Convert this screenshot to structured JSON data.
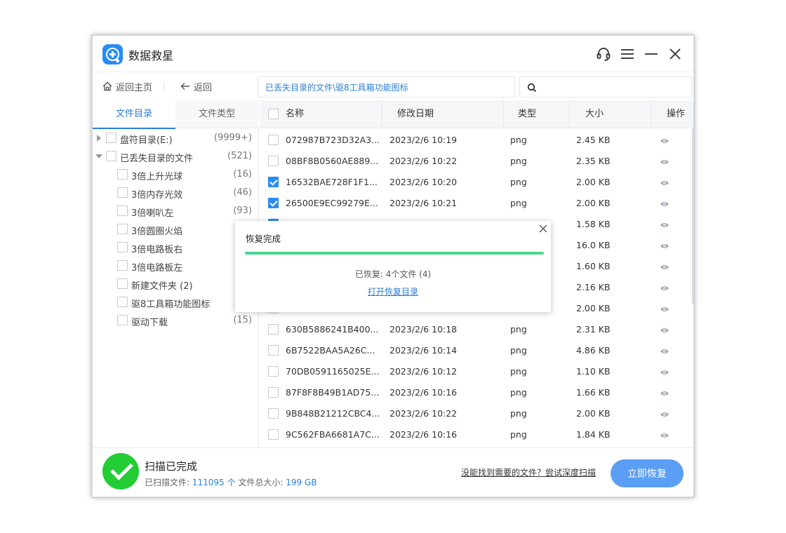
{
  "app": {
    "title": "数据救星"
  },
  "toolbar": {
    "home_label": "返回主页",
    "back_label": "返回",
    "path": "已丢失目录的文件\\驱8工具箱功能图标",
    "search_placeholder": ""
  },
  "left_tabs": [
    {
      "label": "文件目录",
      "active": true
    },
    {
      "label": "文件类型",
      "active": false
    }
  ],
  "tree": [
    {
      "label": "盘符目录(E:)",
      "count": "(9999+)",
      "level": 0,
      "caret": "right"
    },
    {
      "label": "已丢失目录的文件",
      "count": "(521)",
      "level": 0,
      "caret": "down"
    },
    {
      "label": "3倍上升光球",
      "count": "(16)",
      "level": 1
    },
    {
      "label": "3倍内存光效",
      "count": "(46)",
      "level": 1
    },
    {
      "label": "3倍喇叭左",
      "count": "(93)",
      "level": 1
    },
    {
      "label": "3倍圆圈火焰",
      "count": "",
      "level": 1
    },
    {
      "label": "3倍电路板右",
      "count": "",
      "level": 1
    },
    {
      "label": "3倍电路板左",
      "count": "",
      "level": 1
    },
    {
      "label": "新建文件夹 (2)",
      "count": "",
      "level": 1
    },
    {
      "label": "驱8工具箱功能图标",
      "count": "",
      "level": 1
    },
    {
      "label": "驱动下载",
      "count": "(15)",
      "level": 1
    }
  ],
  "table": {
    "headers": {
      "name": "名称",
      "date": "修改日期",
      "type": "类型",
      "size": "大小",
      "action": "操作"
    },
    "rows": [
      {
        "name": "072987B723D32A3...",
        "date": "2023/2/6 10:19",
        "type": "png",
        "size": "2.45 KB",
        "checked": false
      },
      {
        "name": "08BF8B0560AE889...",
        "date": "2023/2/6 10:22",
        "type": "png",
        "size": "2.35 KB",
        "checked": false
      },
      {
        "name": "16532BAE728F1F1...",
        "date": "2023/2/6 10:20",
        "type": "png",
        "size": "2.00 KB",
        "checked": true
      },
      {
        "name": "26500E9EC99279E...",
        "date": "2023/2/6 10:21",
        "type": "png",
        "size": "2.00 KB",
        "checked": true
      },
      {
        "name": "",
        "date": "",
        "type": "",
        "size": "1.58 KB",
        "checked": true
      },
      {
        "name": "",
        "date": "",
        "type": "",
        "size": "16.0 KB",
        "checked": false
      },
      {
        "name": "",
        "date": "",
        "type": "",
        "size": "1.60 KB",
        "checked": false
      },
      {
        "name": "",
        "date": "",
        "type": "",
        "size": "2.16 KB",
        "checked": false
      },
      {
        "name": "",
        "date": "",
        "type": "",
        "size": "2.00 KB",
        "checked": false
      },
      {
        "name": "630B5886241B400...",
        "date": "2023/2/6 10:18",
        "type": "png",
        "size": "2.31 KB",
        "checked": false
      },
      {
        "name": "6B7522BAA5A26C...",
        "date": "2023/2/6 10:14",
        "type": "png",
        "size": "4.86 KB",
        "checked": false
      },
      {
        "name": "70DB0591165025E...",
        "date": "2023/2/6 10:12",
        "type": "png",
        "size": "1.10 KB",
        "checked": false
      },
      {
        "name": "87F8F8B49B1AD75...",
        "date": "2023/2/6 10:16",
        "type": "png",
        "size": "1.66 KB",
        "checked": false
      },
      {
        "name": "9B848B21212CBC4...",
        "date": "2023/2/6 10:22",
        "type": "png",
        "size": "2.00 KB",
        "checked": false
      },
      {
        "name": "9C562FBA6681A7C...",
        "date": "2023/2/6 10:16",
        "type": "png",
        "size": "1.84 KB",
        "checked": false
      }
    ]
  },
  "footer": {
    "status_title": "扫描已完成",
    "scanned_label": "已扫描文件:",
    "scanned_value": "111095 个",
    "total_label": "文件总大小:",
    "total_value": "199 GB",
    "deep_scan_link": "没能找到需要的文件？尝试深度扫描",
    "recover_button": "立即恢复"
  },
  "modal": {
    "title": "恢复完成",
    "progress": 1.0,
    "status": "已恢复: 4个文件 (4)",
    "open_link": "打开恢复目录"
  },
  "colors": {
    "accent": "#2a8cf2",
    "success": "#22cc33",
    "progress": "#4cd590",
    "button": "#5b9ef5"
  },
  "icons": [
    "logo-icon",
    "headset-icon",
    "menu-icon",
    "minimize-icon",
    "close-icon",
    "home-icon",
    "back-arrow-icon",
    "search-icon",
    "eye-icon",
    "check-circle-icon"
  ]
}
